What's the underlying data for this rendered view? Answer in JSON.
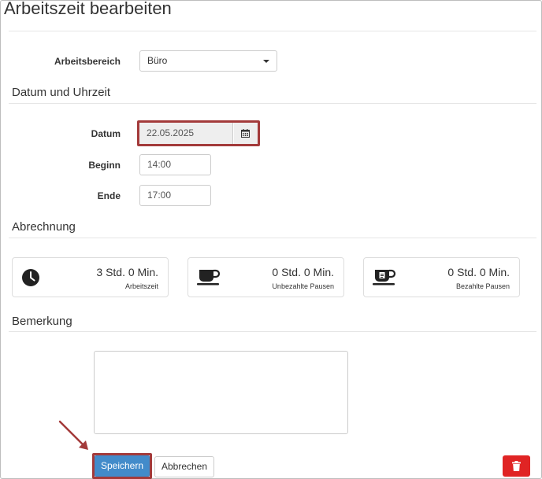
{
  "page": {
    "title": "Arbeitszeit bearbeiten"
  },
  "work_area": {
    "label": "Arbeitsbereich",
    "value": "Büro"
  },
  "datetime_section": {
    "title": "Datum und Uhrzeit",
    "date_label": "Datum",
    "date_value": "22.05.2025",
    "date_icon": "calendar-icon",
    "start_label": "Beginn",
    "start_value": "14:00",
    "end_label": "Ende",
    "end_value": "17:00"
  },
  "billing_section": {
    "title": "Abrechnung",
    "cards": [
      {
        "value": "3 Std. 0 Min.",
        "caption": "Arbeitszeit",
        "icon": "clock-icon"
      },
      {
        "value": "0 Std. 0 Min.",
        "caption": "Unbezahlte Pausen",
        "icon": "coffee-cup-icon"
      },
      {
        "value": "0 Std. 0 Min.",
        "caption": "Bezahlte Pausen",
        "icon": "paid-coffee-cup-icon"
      }
    ]
  },
  "remark_section": {
    "title": "Bemerkung",
    "value": ""
  },
  "actions": {
    "save_label": "Speichern",
    "cancel_label": "Abbrechen",
    "delete_icon": "trash-icon"
  },
  "colors": {
    "primary": "#428bca",
    "danger": "#e02424",
    "annotation": "#a33a3a"
  }
}
